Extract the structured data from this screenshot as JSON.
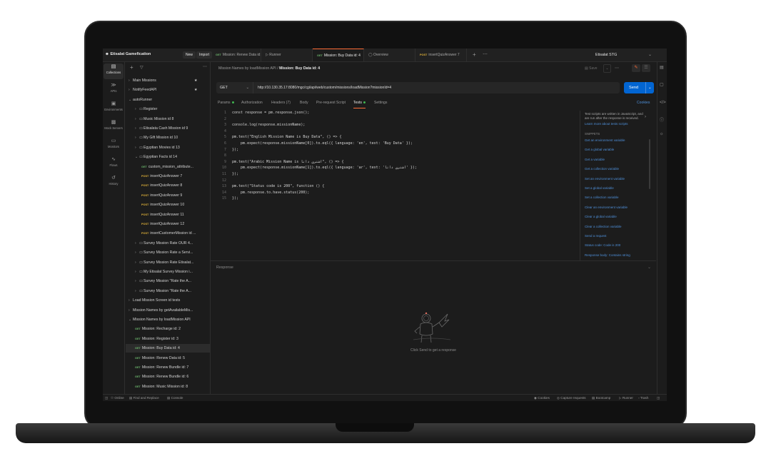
{
  "workspace": {
    "name": "Etisalat Gamefication",
    "new_label": "New",
    "import_label": "Import"
  },
  "tabs": [
    {
      "method": "GET",
      "label": "Mission: Renew Data id:"
    },
    {
      "method": "",
      "label": "Runner"
    },
    {
      "method": "GET",
      "label": "Mission: Buy Data id: 4"
    },
    {
      "method": "",
      "label": "Overview"
    },
    {
      "method": "POST",
      "label": "insertQuizAnswer 7"
    }
  ],
  "environment": "Etisalat STG",
  "rail": [
    "Collections",
    "APIs",
    "Environments",
    "Mock Servers",
    "Monitors",
    "Flows",
    "History"
  ],
  "tree": [
    {
      "indent": 0,
      "type": "folder",
      "label": "Main Missions",
      "chev": ">"
    },
    {
      "indent": 0,
      "type": "folder",
      "label": "NotifyFeedAPI",
      "chev": ">"
    },
    {
      "indent": 0,
      "type": "folder",
      "label": "autoRunner",
      "chev": "v"
    },
    {
      "indent": 1,
      "type": "folder",
      "label": "Register",
      "chev": ">"
    },
    {
      "indent": 1,
      "type": "folder",
      "label": "Music Mission id 8",
      "chev": ">"
    },
    {
      "indent": 1,
      "type": "folder",
      "label": "Etisalata Cash Mission id 9",
      "chev": ">"
    },
    {
      "indent": 1,
      "type": "folder",
      "label": "My Gift Mission id 10",
      "chev": ">"
    },
    {
      "indent": 1,
      "type": "folder",
      "label": "Egyptian Movies id 13",
      "chev": ">"
    },
    {
      "indent": 1,
      "type": "folder",
      "label": "Egyptian Facts id 14",
      "chev": "v"
    },
    {
      "indent": 2,
      "type": "req",
      "method": "GET",
      "label": "custom_mission_attribute..."
    },
    {
      "indent": 2,
      "type": "req",
      "method": "POST",
      "label": "insertQuizAnswer 7"
    },
    {
      "indent": 2,
      "type": "req",
      "method": "POST",
      "label": "insertQuizAnswer 8"
    },
    {
      "indent": 2,
      "type": "req",
      "method": "POST",
      "label": "insertQuizAnswer 9"
    },
    {
      "indent": 2,
      "type": "req",
      "method": "POST",
      "label": "insertQuizAnswer 10"
    },
    {
      "indent": 2,
      "type": "req",
      "method": "POST",
      "label": "insertQuizAnswer 11"
    },
    {
      "indent": 2,
      "type": "req",
      "method": "POST",
      "label": "insertQuizAnswer 12"
    },
    {
      "indent": 2,
      "type": "req",
      "method": "POST",
      "label": "insertCustomerMission id ..."
    },
    {
      "indent": 1,
      "type": "folder",
      "label": "Survey Mission Rate OUR 4...",
      "chev": ">"
    },
    {
      "indent": 1,
      "type": "folder",
      "label": "Survey Mission Rate a Servi...",
      "chev": ">"
    },
    {
      "indent": 1,
      "type": "folder",
      "label": "Survey Mission Rate Etisalat...",
      "chev": ">"
    },
    {
      "indent": 1,
      "type": "folder",
      "label": "My Etisalat Survey Mission i...",
      "chev": ">"
    },
    {
      "indent": 1,
      "type": "folder",
      "label": "Survey Mission \"Rate the A...",
      "chev": ">"
    },
    {
      "indent": 1,
      "type": "folder",
      "label": "Survey Mission \"Rate the A...",
      "chev": ">"
    },
    {
      "indent": 0,
      "type": "folder",
      "label": "Load Mission Screen id tests",
      "chev": ">"
    },
    {
      "indent": 0,
      "type": "folder",
      "label": "Mission Names by getAvailableMis...",
      "chev": ">"
    },
    {
      "indent": 0,
      "type": "folder",
      "label": "Mission Names by loadMission API",
      "chev": "v"
    },
    {
      "indent": 1,
      "type": "req",
      "method": "GET",
      "label": "Mission: Recharge id: 2"
    },
    {
      "indent": 1,
      "type": "req",
      "method": "GET",
      "label": "Mission: Register id: 3"
    },
    {
      "indent": 1,
      "type": "req",
      "method": "GET",
      "label": "Mission: Buy Data id: 4",
      "selected": true
    },
    {
      "indent": 1,
      "type": "req",
      "method": "GET",
      "label": "Mission: Renew Data id: 5"
    },
    {
      "indent": 1,
      "type": "req",
      "method": "GET",
      "label": "Mission: Renew Bundle id: 7"
    },
    {
      "indent": 1,
      "type": "req",
      "method": "GET",
      "label": "Mission: Renew Bundle id: 6"
    },
    {
      "indent": 1,
      "type": "req",
      "method": "GET",
      "label": "Mission: Music Mission id: 8"
    }
  ],
  "breadcrumb": {
    "parent": "Mission Names by loadMission API",
    "sep": "/",
    "current": "Mission: Buy Data id: 4"
  },
  "header_actions": {
    "save": "Save"
  },
  "request": {
    "method": "GET",
    "url": "http://10.130.35.17:8080/mgc/cgi/api/web/custom/missions/loadMission?missionId=4",
    "send_label": "Send"
  },
  "req_tabs": [
    "Params",
    "Authorization",
    "Headers (7)",
    "Body",
    "Pre-request Script",
    "Tests",
    "Settings"
  ],
  "cookies_label": "Cookies",
  "code_lines": [
    "const response = pm.response.json();",
    "",
    "console.log(response.missionName);",
    "",
    "pm.test(\"English Mission Name is Buy Data\", () => {",
    "    pm.expect(response.missionName[0]).to.eql({ language: 'en', text: 'Buy Data' });",
    "});",
    "",
    "pm.test(\"Arabic Mission Name is اشتري داتا\", () => {",
    "    pm.expect(response.missionName[1]).to.eql({ language: 'ar', text: 'اشتري داتا' });",
    "});",
    "",
    "pm.test(\"Status code is 200\", function () {",
    "    pm.response.to.have.status(200);",
    "});"
  ],
  "snippets": {
    "note": "Test scripts are written in JavaScript, and are run after the response is received.",
    "learn_more": "Learn more about tests scripts",
    "heading": "SNIPPETS",
    "items": [
      "Get an environment variable",
      "Get a global variable",
      "Get a variable",
      "Get a collection variable",
      "Set an environment variable",
      "Set a global variable",
      "Set a collection variable",
      "Clear an environment variable",
      "Clear a global variable",
      "Clear a collection variable",
      "Send a request",
      "Status code: Code is 200",
      "Response body: Contains string"
    ]
  },
  "response": {
    "label": "Response",
    "hint": "Click Send to get a response"
  },
  "status_bar": {
    "left": [
      "Online",
      "Find and Replace",
      "Console"
    ],
    "right": [
      "Cookies",
      "Capture requests",
      "Bootcamp",
      "Runner",
      "Trash"
    ]
  },
  "colors": {
    "accent": "#ff6c37",
    "send": "#0265d2",
    "get": "#6bb26b",
    "post": "#e0b23a",
    "link": "#4e8fd8"
  }
}
